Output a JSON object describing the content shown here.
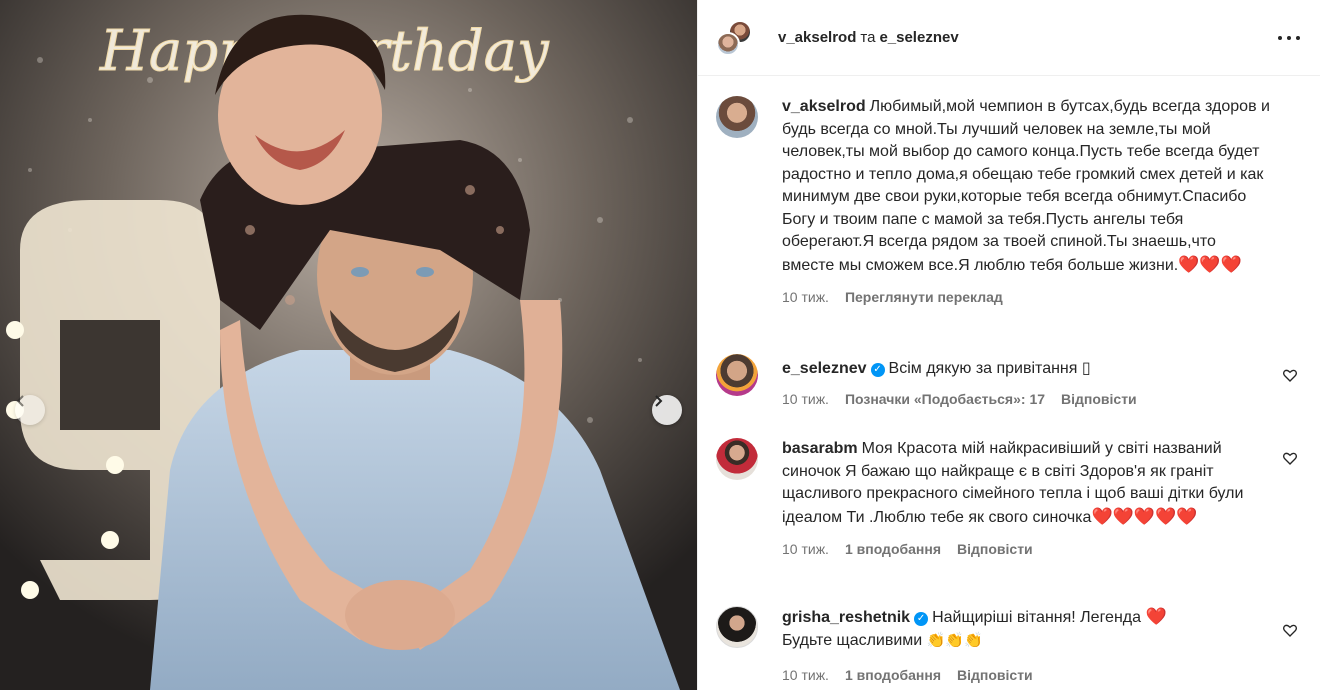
{
  "post": {
    "author1": "v_akselrod",
    "conjunction": "та",
    "author2": "e_seleznev",
    "photo_sign": "Happy Birthday"
  },
  "caption": {
    "user": "v_akselrod",
    "text": "Любимый,мой чемпион в бутсах,будь всегда здоров и будь всегда со мной.Ты лучший человек на земле,ты мой человек,ты мой выбор до самого конца.Пусть тебе всегда будет радостно и тепло дома,я обещаю тебе громкий смех детей и как минимум две свои руки,которые тебя всегда обнимут.Спасибо Богу и твоим папе с мамой за тебя.Пусть ангелы тебя оберегают.Я всегда рядом за твоей спиной.Ты знаешь,что вместе мы сможем все.Я люблю тебя больше жизни.",
    "emoji": "❤️❤️❤️",
    "time": "10 тиж.",
    "translate": "Переглянути переклад"
  },
  "comments": [
    {
      "user": "e_seleznev",
      "text": "Всім дякую за привітання",
      "glyph": "▯",
      "time": "10 тиж.",
      "likes": "Позначки «Подобається»: 17",
      "reply": "Відповісти"
    },
    {
      "user": "basarabm",
      "text": "Моя Красота мій найкрасивіший у світі названий синочок Я бажаю що найкраще є в світі Здоров'я як граніт щасливого прекрасного сімейного тепла і щоб ваші дітки були ідеалом Ти .Люблю тебе як свого синочка",
      "emoji": "❤️❤️❤️❤️❤️",
      "time": "10 тиж.",
      "likes": "1 вподобання",
      "reply": "Відповісти"
    },
    {
      "user": "grisha_reshetnik",
      "text_line1": "Найщиріші вітання! Легенда",
      "emoji1": "❤️",
      "text_line2": "Будьте щасливими",
      "emoji2": "👏👏👏",
      "time": "10 тиж.",
      "likes": "1 вподобання",
      "reply": "Відповісти"
    }
  ],
  "icons": {
    "more": "more-options-icon",
    "like": "heart-outline-icon",
    "prev": "chevron-left-icon",
    "next": "chevron-right-icon",
    "verified": "verified-badge-icon"
  },
  "colors": {
    "verified": "#0095f6",
    "text": "#262626",
    "secondary": "#737373",
    "border": "#efefef"
  }
}
